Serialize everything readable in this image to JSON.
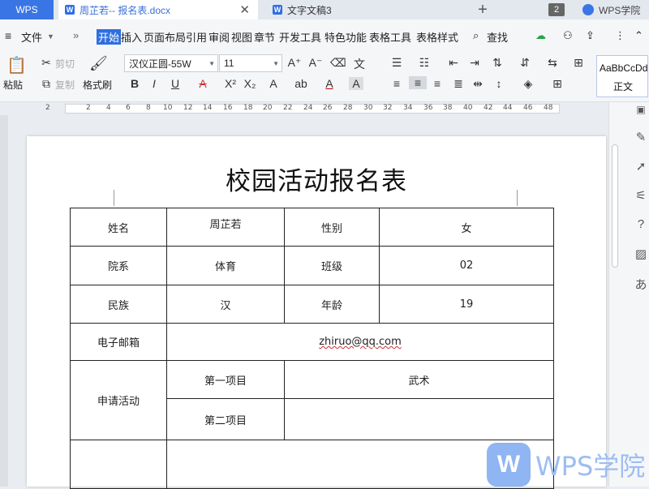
{
  "tabs": {
    "app": "WPS",
    "doc1": "周芷若-- 报名表.docx",
    "doc1_icon": "W",
    "doc2": "文字文稿3",
    "doc2_icon": "W",
    "new_tab": "+",
    "count": "2",
    "academy": "WPS学院"
  },
  "menu": {
    "file": "文件",
    "items": [
      "开始",
      "插入",
      "页面布局",
      "引用",
      "审阅",
      "视图",
      "章节",
      "开发工具",
      "特色功能",
      "表格工具",
      "表格样式"
    ],
    "search": "查找"
  },
  "ribbon": {
    "paste": "粘贴",
    "cut": "剪切",
    "copy": "复制",
    "format_painter": "格式刷",
    "font_name": "汉仪正圆-55W",
    "font_size": "11",
    "style_preview": "AaBbCcDd",
    "style_name": "正文"
  },
  "ruler": {
    "ticks": [
      "2",
      "2",
      "4",
      "6",
      "8",
      "10",
      "12",
      "14",
      "16",
      "18",
      "20",
      "22",
      "24",
      "26",
      "28",
      "30",
      "32",
      "34",
      "36",
      "38",
      "40",
      "42",
      "44",
      "46",
      "48"
    ]
  },
  "document": {
    "title": "校园活动报名表",
    "rows": {
      "name_label": "姓名",
      "name_value": "周芷若",
      "gender_label": "性别",
      "gender_value": "女",
      "dept_label": "院系",
      "dept_value": "体育",
      "class_label": "班级",
      "class_value": "02",
      "ethnic_label": "民族",
      "ethnic_value": "汉",
      "age_label": "年龄",
      "age_value": "19",
      "email_label": "电子邮箱",
      "email_value": "zhiruo@qq.com",
      "apply_label": "申请活动",
      "item1_label": "第一项目",
      "item1_value": "武术",
      "item2_label": "第二项目",
      "item2_value": ""
    }
  },
  "watermark": {
    "text": "WPS学院"
  },
  "colors": {
    "accent": "#2d6fe2",
    "watermark": "#9dbdf2"
  }
}
